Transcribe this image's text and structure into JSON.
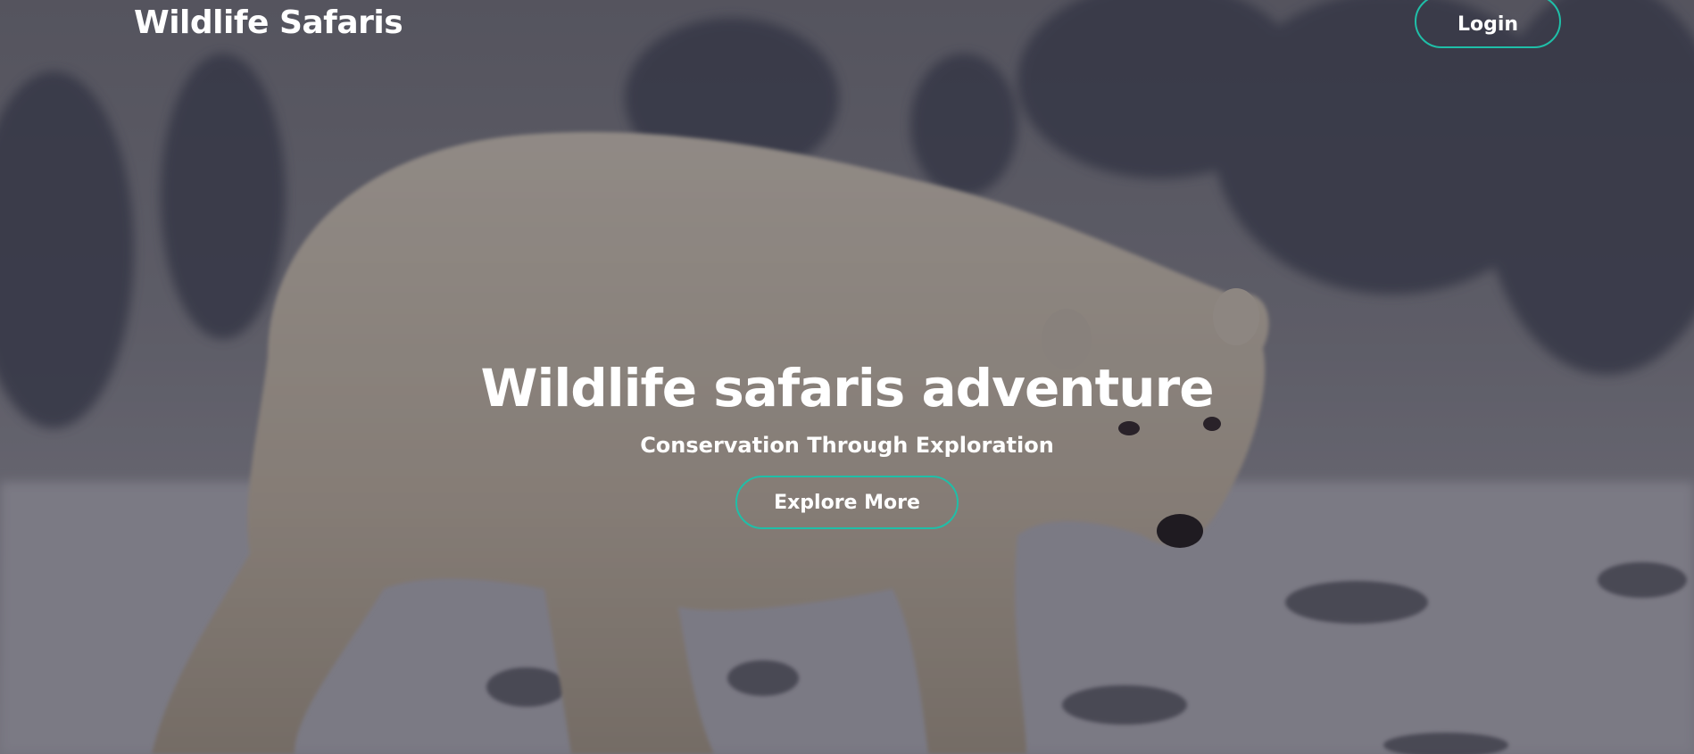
{
  "header": {
    "brand": "Wildlife Safaris",
    "login_label": "Login"
  },
  "hero": {
    "title": "Wildlife safaris adventure",
    "subtitle": "Conservation Through Exploration",
    "cta_label": "Explore More",
    "image_subject": "polar-bear-in-snow"
  },
  "colors": {
    "accent_border": "#1fbfa8",
    "text": "#ffffff",
    "overlay": "#282837"
  }
}
